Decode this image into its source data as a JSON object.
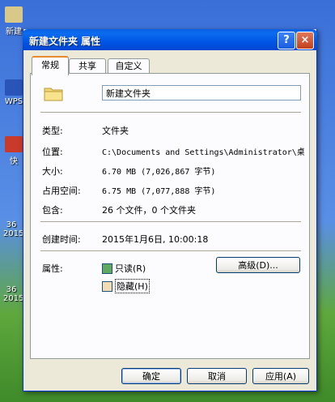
{
  "desktop": {
    "icons": [
      {
        "label": "新建"
      },
      {
        "label": "WPS"
      },
      {
        "label": "快"
      },
      {
        "label": "36 2015"
      },
      {
        "label": "36 2015"
      }
    ]
  },
  "window": {
    "title": "新建文件夹 属性",
    "help_glyph": "?",
    "close_glyph": "×"
  },
  "tabs": [
    {
      "label": "常规"
    },
    {
      "label": "共享"
    },
    {
      "label": "自定义"
    }
  ],
  "general": {
    "folder_name": "新建文件夹",
    "type_label": "类型:",
    "type_value": "文件夹",
    "location_label": "位置:",
    "location_value": "C:\\Documents and Settings\\Administrator\\桌",
    "size_label": "大小:",
    "size_value": "6.70 MB (7,026,867 字节)",
    "disk_label": "占用空间:",
    "disk_value": "6.75 MB (7,077,888 字节)",
    "contains_label": "包含:",
    "contains_value": "26 个文件，0 个文件夹",
    "created_label": "创建时间:",
    "created_value": "2015年1月6日, 10:00:18",
    "attributes_label": "属性:",
    "readonly_label": "只读(R)",
    "hidden_label": "隐藏(H)",
    "advanced_button": "高级(D)..."
  },
  "buttons": {
    "ok": "确定",
    "cancel": "取消",
    "apply": "应用(A)"
  },
  "colors": {
    "title_blue": "#0055e5",
    "close_red": "#c2401c",
    "dialog_bg": "#ece9d8",
    "tab_accent": "#e68b2c"
  }
}
